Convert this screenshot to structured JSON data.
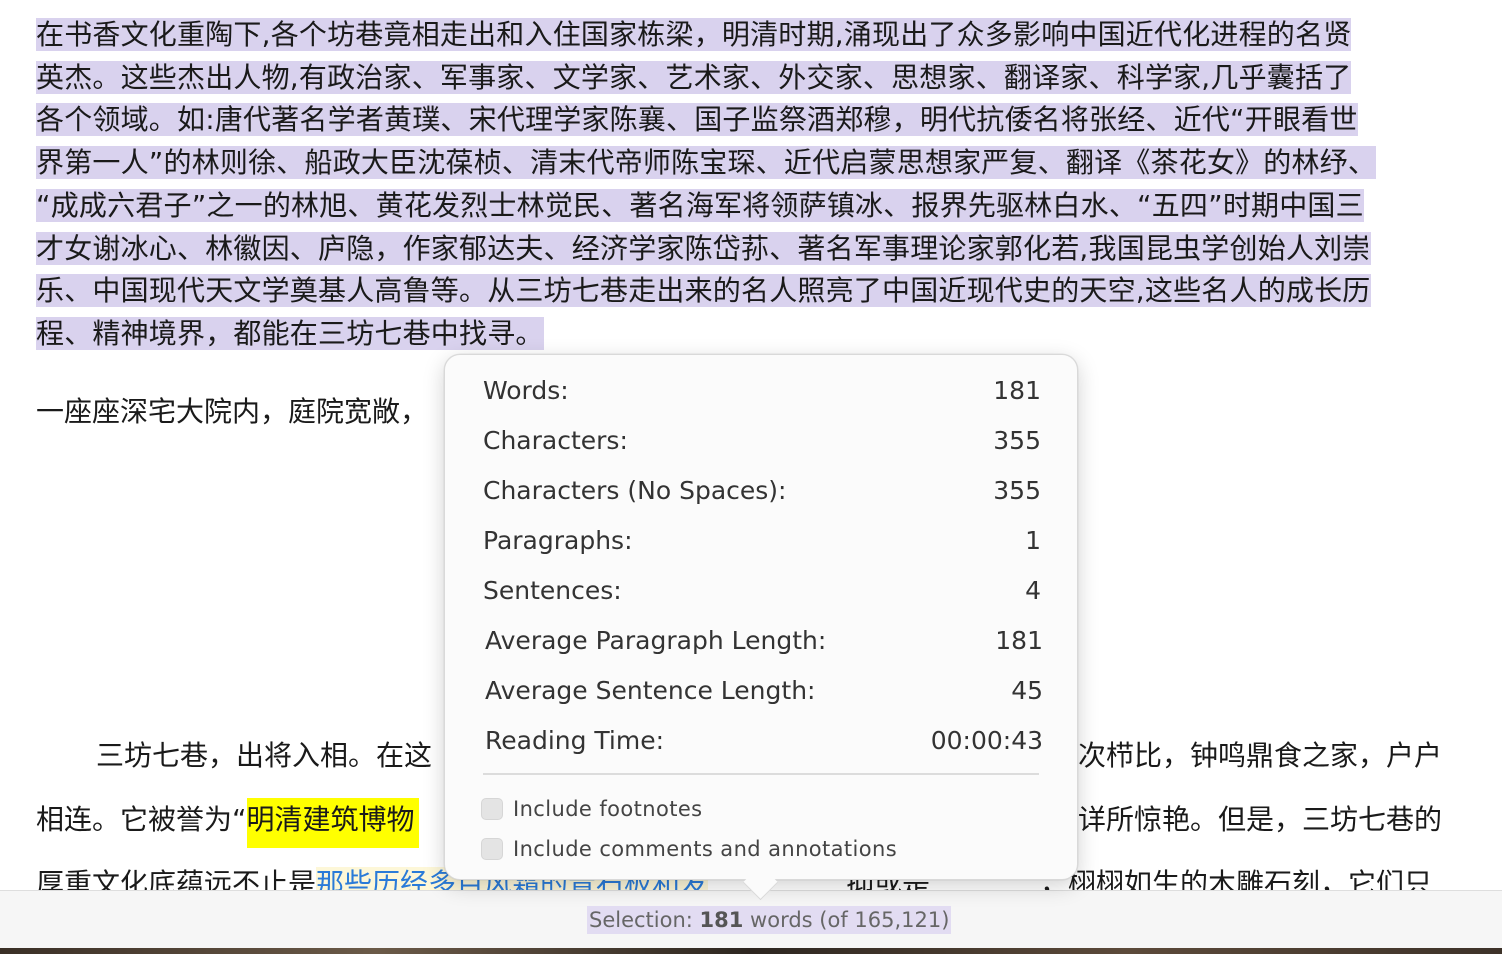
{
  "document": {
    "selected_paragraph_lines": [
      "在书香文化重陶下,各个坊巷竟相走出和入住国家栋梁，明清时期,涌现出了众多影响中国近代化进程的名贤",
      "英杰。这些杰出人物,有政治家、军事家、文学家、艺术家、外交家、思想家、翻译家、科学家,几乎囊括了",
      "各个领域。如:唐代著名学者黄璞、宋代理学家陈襄、国子监祭酒郑穆，明代抗倭名将张经、近代“开眼看世",
      "界第一人”的林则徐、船政大臣沈葆桢、清末代帝师陈宝琛、近代启蒙思想家严复、翻译《茶花女》的林纾、",
      "“成成六君子”之一的林旭、黄花发烈士林觉民、著名海军将领萨镇冰、报界先驱林白水、“五四”时期中国三",
      "才女谢冰心、林徽因、庐隐，作家郁达夫、经济学家陈岱荪、著名军事理论家郭化若,我国昆虫学创始人刘崇",
      "乐、中国现代天文学奠基人高鲁等。从三坊七巷走出来的名人照亮了中国近现代史的天空,这些名人的成长历",
      "程、精神境界，都能在三坊七巷中找寻。"
    ],
    "second_paragraph_start": "一座座深宅大院内，庭院宽敞，",
    "third_paragraph": {
      "line1_left": "三坊七巷，出将入相。在这",
      "line1_right": "次栉比，钟鸣鼎食之家，户户",
      "line2_left_plain": "相连。它被誉为“",
      "line2_left_yellow": "明清建筑博物",
      "line2_right": "详所惊艳。但是，三坊七巷的",
      "line3_left_plain": "厚重文化底蕴远不止是",
      "line3_left_blue": "那些历经多百风霜的青石板和发",
      "line3_right": "抑或是",
      "line3_right2": "，栩栩如生的木雕石刻，它们只"
    }
  },
  "word_count_popover": {
    "stats": [
      {
        "label": "Words:",
        "value": "181"
      },
      {
        "label": "Characters:",
        "value": "355"
      },
      {
        "label": "Characters (No Spaces):",
        "value": "355"
      },
      {
        "label": "Paragraphs:",
        "value": "1"
      },
      {
        "label": "Sentences:",
        "value": "4"
      },
      {
        "label": "Average Paragraph Length:",
        "value": "181"
      },
      {
        "label": "Average Sentence Length:",
        "value": "45"
      },
      {
        "label": "Reading Time:",
        "value": "00:00:43"
      }
    ],
    "options": [
      {
        "label": "Include footnotes",
        "checked": false
      },
      {
        "label": "Include comments and annotations",
        "checked": false
      }
    ]
  },
  "statusbar": {
    "prefix": "Selection: ",
    "count": "181",
    "suffix": " words (of 165,121)"
  },
  "colors": {
    "selection_highlight": "#d9d2ee",
    "yellow_highlight": "#ffff00",
    "blue_text": "#2a7bd8"
  }
}
